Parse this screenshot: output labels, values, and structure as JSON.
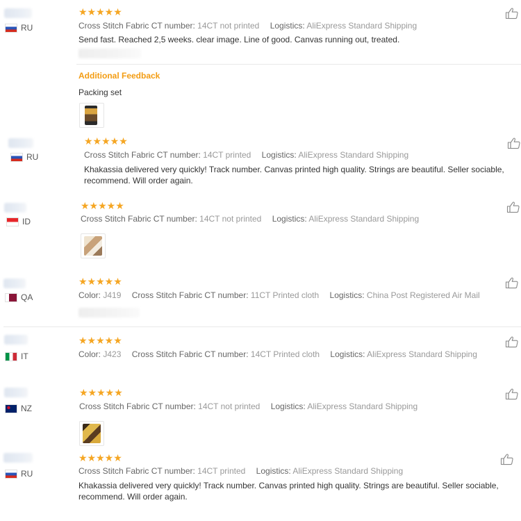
{
  "reviews": [
    {
      "country": "RU",
      "stars": "★★★★★",
      "fields": [
        {
          "k": "Cross Stitch Fabric CT number:",
          "v": "14CT not printed"
        },
        {
          "k": "Logistics:",
          "v": "AliExpress Standard Shipping"
        }
      ],
      "text": "Send fast. Reached 2,5 weeks. clear image. Line of good. Canvas running out, treated.",
      "additional_label": "Additional Feedback",
      "additional_text": "Packing set"
    },
    {
      "country": "RU",
      "stars": "★★★★★",
      "fields": [
        {
          "k": "Cross Stitch Fabric CT number:",
          "v": "14CT printed"
        },
        {
          "k": "Logistics:",
          "v": "AliExpress Standard Shipping"
        }
      ],
      "text": "Khakassia delivered very quickly! Track number. Canvas printed high quality. Strings are beautiful. Seller sociable, recommend. Will order again."
    },
    {
      "country": "ID",
      "stars": "★★★★★",
      "fields": [
        {
          "k": "Cross Stitch Fabric CT number:",
          "v": "14CT not printed"
        },
        {
          "k": "Logistics:",
          "v": "AliExpress Standard Shipping"
        }
      ]
    },
    {
      "country": "QA",
      "stars": "★★★★★",
      "fields": [
        {
          "k": "Color:",
          "v": "J419"
        },
        {
          "k": "Cross Stitch Fabric CT number:",
          "v": "11CT Printed cloth"
        },
        {
          "k": "Logistics:",
          "v": "China Post Registered Air Mail"
        }
      ]
    },
    {
      "country": "IT",
      "stars": "★★★★★",
      "fields": [
        {
          "k": "Color:",
          "v": "J423"
        },
        {
          "k": "Cross Stitch Fabric CT number:",
          "v": "14CT Printed cloth"
        },
        {
          "k": "Logistics:",
          "v": "AliExpress Standard Shipping"
        }
      ]
    },
    {
      "country": "NZ",
      "stars": "★★★★★",
      "fields": [
        {
          "k": "Cross Stitch Fabric CT number:",
          "v": "14CT not printed"
        },
        {
          "k": "Logistics:",
          "v": "AliExpress Standard Shipping"
        }
      ]
    },
    {
      "country": "RU",
      "stars": "★★★★★",
      "fields": [
        {
          "k": "Cross Stitch Fabric CT number:",
          "v": "14CT printed"
        },
        {
          "k": "Logistics:",
          "v": "AliExpress Standard Shipping"
        }
      ],
      "text": "Khakassia delivered very quickly! Track number. Canvas printed high quality. Strings are beautiful. Seller sociable, recommend. Will order again."
    }
  ],
  "icons": {
    "like": "thumbs-up-icon",
    "star": "star-icon"
  },
  "colors": {
    "star": "#f5a623",
    "additional": "#f39c12",
    "label": "#666666",
    "value": "#999999"
  }
}
